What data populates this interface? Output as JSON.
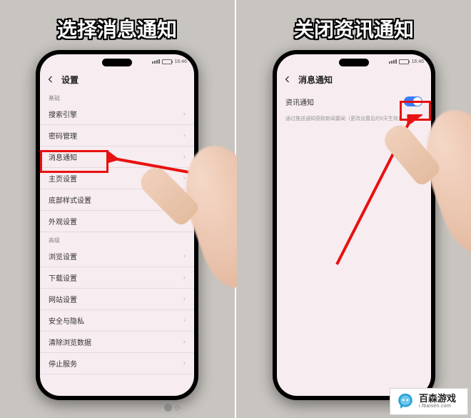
{
  "left_panel": {
    "banner": "选择消息通知",
    "status": {
      "time": "16:46"
    },
    "header": {
      "title": "设置"
    },
    "sections": [
      {
        "label": "基础",
        "items": [
          "搜索引擎",
          "密码管理",
          "消息通知",
          "主页设置",
          "底部样式设置",
          "外观设置"
        ]
      },
      {
        "label": "高级",
        "items": [
          "浏览设置",
          "下载设置",
          "网站设置",
          "安全与隐私",
          "清除浏览数据",
          "停止服务"
        ]
      }
    ],
    "highlight_index": 2
  },
  "right_panel": {
    "banner": "关闭资讯通知",
    "status": {
      "time": "16:46"
    },
    "header": {
      "title": "消息通知"
    },
    "toggle": {
      "label": "资讯通知",
      "on": true
    },
    "description": "通过推送通知获取新闻要闻（更改设置后约5天生效）"
  },
  "watermark": {
    "wx_label": "小",
    "brand_cn": "百森游戏",
    "brand_en": "i.fbaisen.com"
  }
}
